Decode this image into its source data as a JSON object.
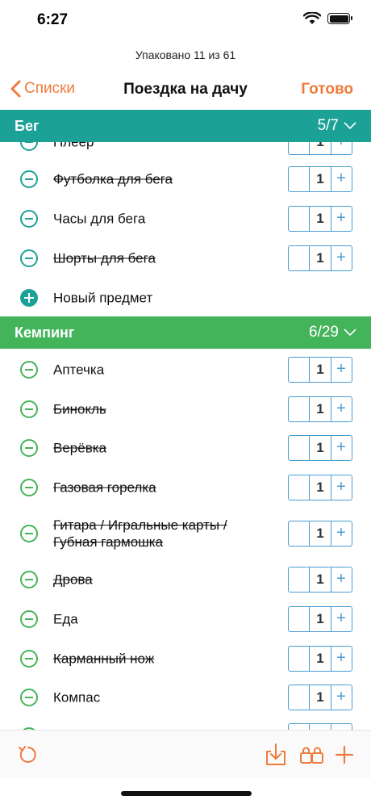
{
  "status": {
    "time": "6:27"
  },
  "header": {
    "packed_text": "Упаковано 11 из 61",
    "back_label": "Списки",
    "title": "Поездка на дачу",
    "done_label": "Готово"
  },
  "sections": [
    {
      "name": "Бег",
      "count": "5/7",
      "items": [
        {
          "label": "Плеер",
          "qty": "1",
          "packed": false
        },
        {
          "label": "Футболка для бега",
          "qty": "1",
          "packed": true
        },
        {
          "label": "Часы для бега",
          "qty": "1",
          "packed": false
        },
        {
          "label": "Шорты для бега",
          "qty": "1",
          "packed": true
        }
      ],
      "new_item_label": "Новый предмет"
    },
    {
      "name": "Кемпинг",
      "count": "6/29",
      "items": [
        {
          "label": "Аптечка",
          "qty": "1",
          "packed": false
        },
        {
          "label": "Бинокль",
          "qty": "1",
          "packed": true
        },
        {
          "label": "Верёвка",
          "qty": "1",
          "packed": true
        },
        {
          "label": "Газовая горелка",
          "qty": "1",
          "packed": true
        },
        {
          "label": "Гитара / Игральные карты / Губная гармошка",
          "qty": "1",
          "packed": true
        },
        {
          "label": "Дрова",
          "qty": "1",
          "packed": true
        },
        {
          "label": "Еда",
          "qty": "1",
          "packed": false
        },
        {
          "label": "Карманный нож",
          "qty": "1",
          "packed": true
        },
        {
          "label": "Компас",
          "qty": "1",
          "packed": false
        },
        {
          "label": "",
          "qty": "1",
          "packed": false
        }
      ]
    }
  ],
  "colors": {
    "accent": "#ef7a3c",
    "section_running": "#1ba196",
    "section_camping": "#44b45a",
    "stepper": "#4a9bd1"
  },
  "toolbar": {
    "icons": [
      "refresh-icon",
      "import-icon",
      "bags-icon",
      "add-icon"
    ]
  }
}
